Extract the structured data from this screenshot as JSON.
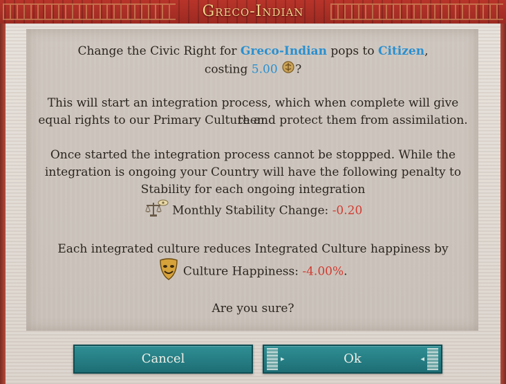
{
  "dialog": {
    "title": "Greco-Indian",
    "line1_prefix": "Change the Civic Right for ",
    "culture": "Greco-Indian",
    "line1_mid": " pops to ",
    "right": "Citizen",
    "line1_suffix": ",",
    "cost_prefix": "costing ",
    "cost_value": "5.00",
    "cost_suffix": "?",
    "para2_l1": "This will start an integration process, which when complete will give them",
    "para2_l2": "equal rights to our Primary Culture and protect them from assimilation.",
    "para3_l1": "Once started the integration process cannot be stoppped. While the",
    "para3_l2": "integration is ongoing your Country will have the following penalty to",
    "para3_l3": "Stability for each ongoing integration",
    "stability_label": "Monthly Stability Change: ",
    "stability_value": "-0.20",
    "para4_l1": "Each integrated culture reduces Integrated Culture happiness by",
    "happiness_label": "Culture Happiness: ",
    "happiness_value": "-4.00%",
    "happiness_suffix": ".",
    "confirm": "Are you sure?",
    "cancel_label": "Cancel",
    "ok_label": "Ok"
  },
  "colors": {
    "highlight": "#2a8fd0",
    "negative": "#d23a30",
    "title": "#f3d38b",
    "button": "#2f8f94"
  },
  "icons": {
    "cost": "political-influence-icon",
    "stability": "scales-stability-icon",
    "happiness": "theater-mask-icon"
  }
}
